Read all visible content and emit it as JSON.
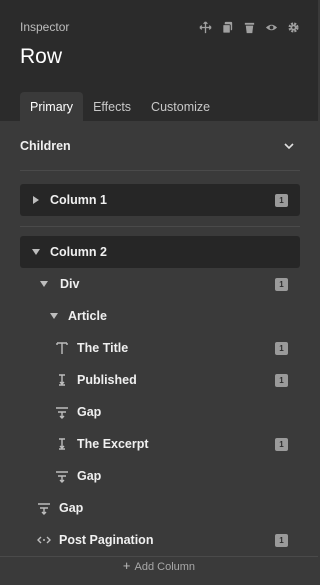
{
  "header": {
    "label": "Inspector",
    "title": "Row",
    "tools": [
      "move-icon",
      "copy-icon",
      "delete-icon",
      "eye-icon",
      "gear-icon"
    ]
  },
  "tabs": [
    {
      "label": "Primary",
      "active": true
    },
    {
      "label": "Effects",
      "active": false
    },
    {
      "label": "Customize",
      "active": false
    }
  ],
  "children_section": {
    "title": "Children"
  },
  "tree": {
    "column1": {
      "label": "Column 1",
      "badge": "1"
    },
    "column2": {
      "label": "Column 2"
    },
    "div": {
      "label": "Div",
      "badge": "1"
    },
    "article": {
      "label": "Article"
    },
    "the_title": {
      "label": "The Title",
      "badge": "1"
    },
    "published": {
      "label": "Published",
      "badge": "1"
    },
    "gap1": {
      "label": "Gap"
    },
    "the_excerpt": {
      "label": "The Excerpt",
      "badge": "1"
    },
    "gap2": {
      "label": "Gap"
    },
    "gap3": {
      "label": "Gap"
    },
    "post_pagination": {
      "label": "Post Pagination",
      "badge": "1"
    }
  },
  "add_column": {
    "label": "Add Column"
  }
}
